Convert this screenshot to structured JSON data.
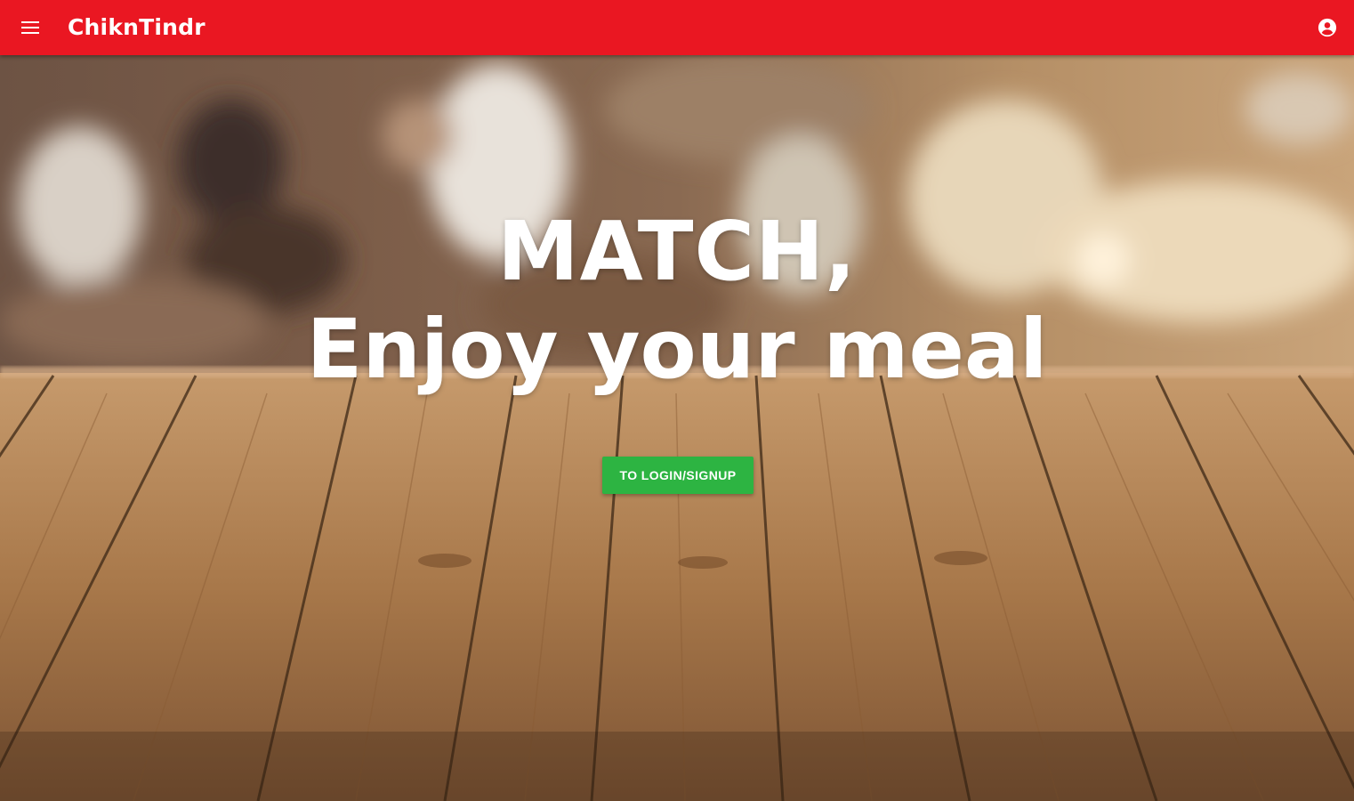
{
  "appbar": {
    "brand": "ChiknTindr",
    "color": "#ea1722",
    "menu_icon": "menu-icon",
    "account_icon": "account-circle-icon"
  },
  "hero": {
    "headline_line1": "MATCH,",
    "headline_line2": "Enjoy your meal",
    "cta_label": "TO LOGIN/SIGNUP",
    "cta_color": "#2db442",
    "background": "blurred-restaurant-over-wooden-table"
  }
}
